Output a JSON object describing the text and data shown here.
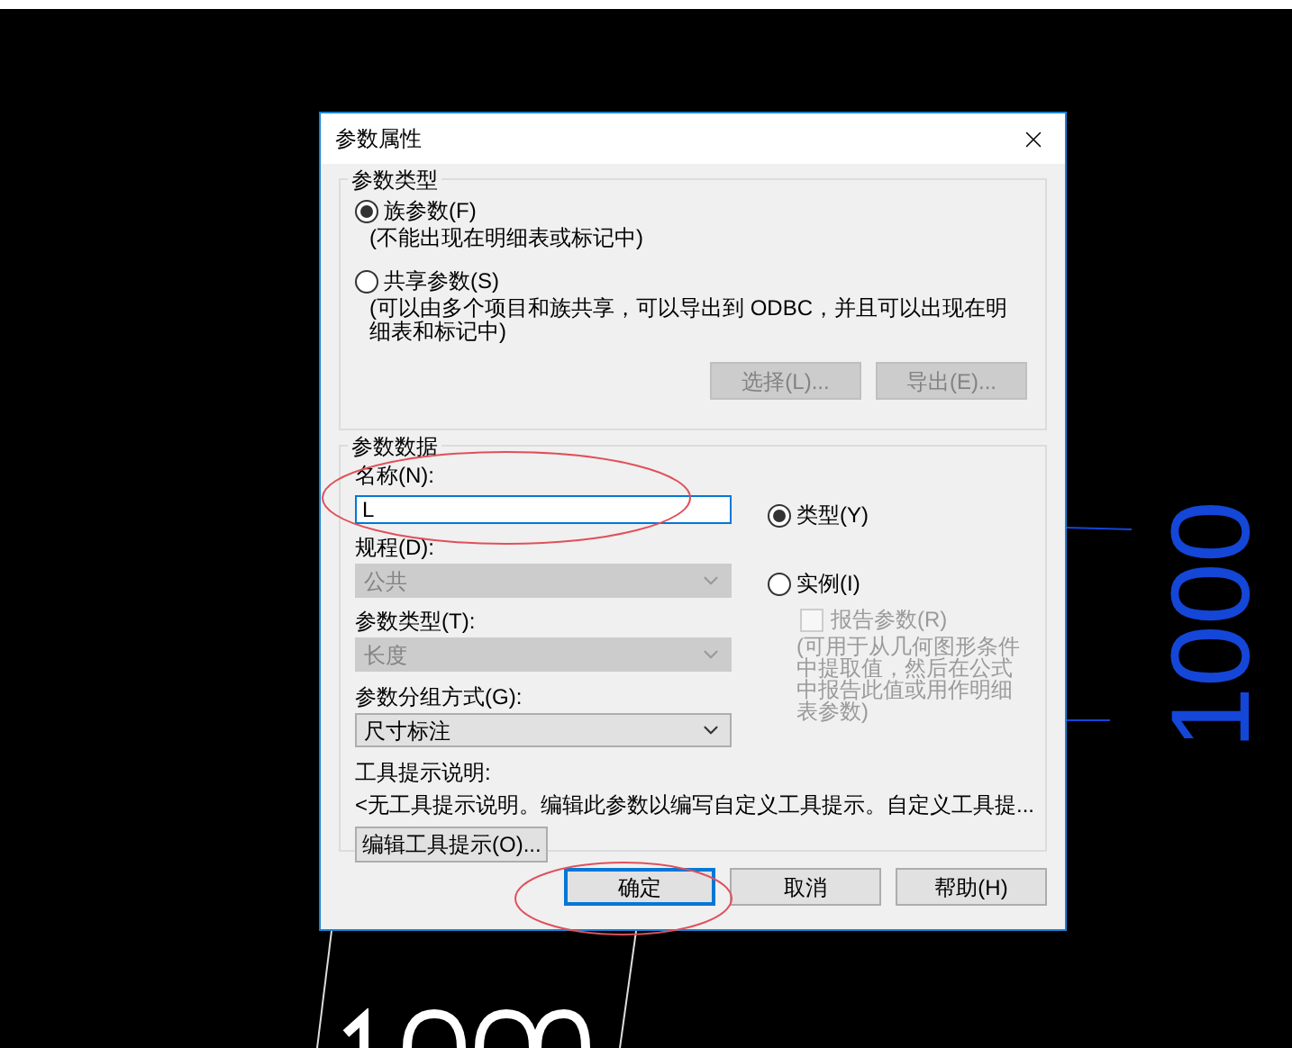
{
  "window": {
    "title": "参数属性"
  },
  "type_group": {
    "legend": "参数类型",
    "options": [
      {
        "label": "族参数(F)",
        "note": "(不能出现在明细表或标记中)",
        "selected": true
      },
      {
        "label": "共享参数(S)",
        "note": "(可以由多个项目和族共享，可以导出到 ODBC，并且可以出现在明细表和标记中)",
        "selected": false
      }
    ],
    "buttons": [
      {
        "label": "选择(L)...",
        "disabled": true
      },
      {
        "label": "导出(E)...",
        "disabled": true
      }
    ]
  },
  "data_group": {
    "legend": "参数数据",
    "name_field": {
      "label": "名称(N):",
      "value": "L"
    },
    "discipline": {
      "label": "规程(D):",
      "value": "公共",
      "disabled": true
    },
    "param_type": {
      "label": "参数类型(T):",
      "value": "长度",
      "disabled": true
    },
    "group_by": {
      "label": "参数分组方式(G):",
      "value": "尺寸标注",
      "disabled": false
    },
    "scope_options": [
      {
        "label": "类型(Y)",
        "selected": true
      },
      {
        "label": "实例(I)",
        "selected": false
      }
    ],
    "report_param": {
      "label": "报告参数(R)",
      "checked": false,
      "disabled": true,
      "note": "(可用于从几何图形条件中提取值，然后在公式中报告此值或用作明细表参数)"
    },
    "tooltip": {
      "label": "工具提示说明:",
      "text": "<无工具提示说明。编辑此参数以编写自定义工具提示。自定义工具提..."
    },
    "edit_tooltip_button": "编辑工具提示(O)..."
  },
  "footer_buttons": [
    {
      "label": "确定",
      "default": true
    },
    {
      "label": "取消",
      "default": false
    },
    {
      "label": "帮助(H)",
      "default": false
    }
  ],
  "dimension_text": "1000"
}
